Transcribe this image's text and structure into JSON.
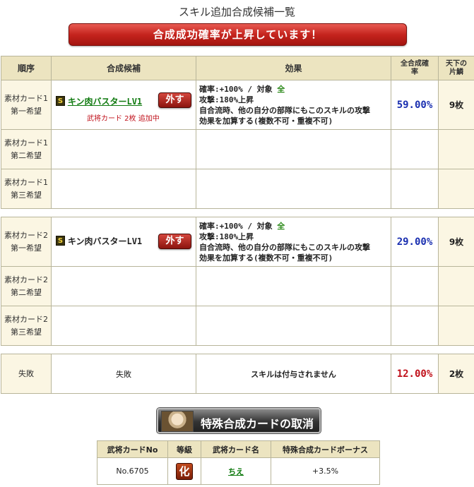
{
  "page_title": "スキル追加合成候補一覧",
  "banner": "合成成功確率が上昇しています！",
  "headers": {
    "order": "順序",
    "candidate": "合成候補",
    "effect": "効果",
    "rate": "全合成確率",
    "count": "天下の片鱗"
  },
  "group1": {
    "rows": [
      {
        "order": [
          "素材カード1",
          "第一希望"
        ]
      },
      {
        "order": [
          "素材カード1",
          "第二希望"
        ]
      },
      {
        "order": [
          "素材カード1",
          "第三希望"
        ]
      }
    ],
    "rank": "S",
    "skill": "キン肉バスターLV1",
    "remove": "外す",
    "note": "武将カード 2枚 追加中",
    "effect": {
      "line1_a": "確率:+100% / 対象 ",
      "line1_b": "全",
      "line2": "攻撃:180%上昇",
      "line3": "自合流時、他の自分の部隊にもこのスキルの攻撃",
      "line4": "効果を加算する(複数不可・重複不可)"
    },
    "rate": "59.00%",
    "count": "9枚"
  },
  "group2": {
    "rows": [
      {
        "order": [
          "素材カード2",
          "第一希望"
        ]
      },
      {
        "order": [
          "素材カード2",
          "第二希望"
        ]
      },
      {
        "order": [
          "素材カード2",
          "第三希望"
        ]
      }
    ],
    "rank": "S",
    "skill": "キン肉バスターLV1",
    "remove": "外す",
    "effect": {
      "line1_a": "確率:+100% / 対象 ",
      "line1_b": "全",
      "line2": "攻撃:180%上昇",
      "line3": "自合流時、他の自分の部隊にもこのスキルの攻撃",
      "line4": "効果を加算する(複数不可・重複不可)"
    },
    "rate": "29.00%",
    "count": "9枚"
  },
  "failure": {
    "order": "失敗",
    "candidate": "失敗",
    "effect": "スキルは付与されません",
    "rate": "12.00%",
    "count": "2枚"
  },
  "cancel_button": "特殊合成カードの取消",
  "card_table": {
    "headers": [
      "武将カードNo",
      "等級",
      "武将カード名",
      "特殊合成カードボーナス"
    ],
    "no": "No.6705",
    "grade": "化",
    "name": "ちえ",
    "bonus": "+3.5%"
  },
  "colors": {
    "header_bg": "#ece4c0",
    "banner_red": "#c5241e",
    "rate_blue": "#1a2fb0",
    "rate_red": "#c0101a",
    "link_green": "#107a10"
  }
}
